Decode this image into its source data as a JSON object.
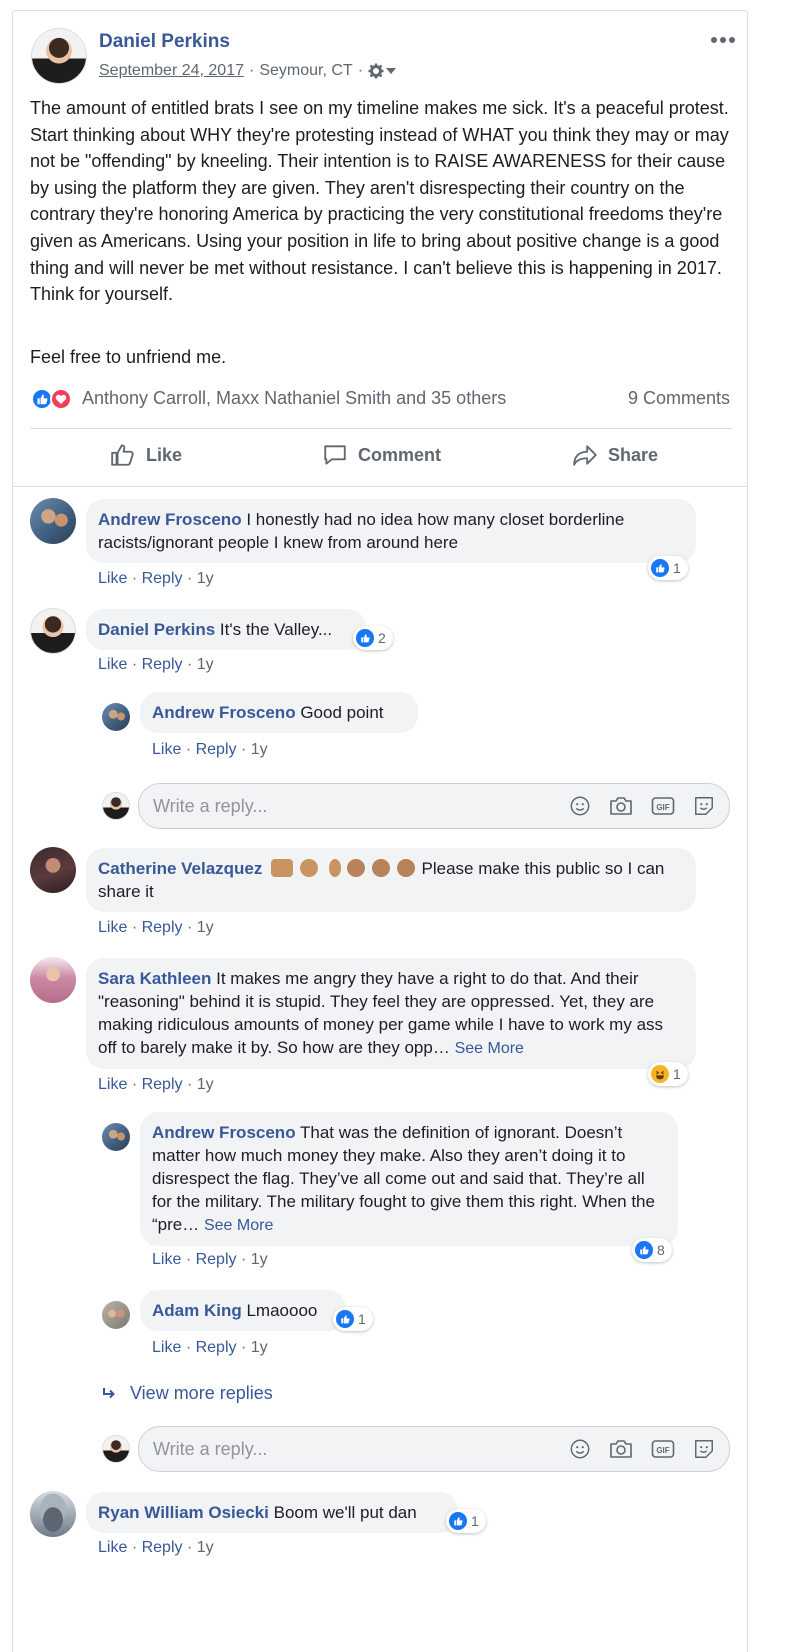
{
  "post": {
    "author": "Daniel Perkins",
    "date": "September 24, 2017",
    "location": "Seymour, CT",
    "separator": "·",
    "menu_icon": "more-horizontal-icon",
    "body": "The amount of entitled brats I see on my timeline makes me sick. It's a peaceful protest. Start thinking about WHY they're protesting instead of WHAT you think they may or may not be \"offending\" by kneeling. Their intention is to RAISE AWARENESS for their cause by using the platform they are given. They aren't disrespecting their country on the contrary they're honoring America by practicing the very constitutional freedoms they're given as Americans. Using your position in life to bring about positive change is a good thing and will never be met without resistance. I can't believe this is happening in 2017. Think for yourself.",
    "footer_line": "Feel free to unfriend me.",
    "reactions_text": "Anthony Carroll, Maxx Nathaniel Smith and 35 others",
    "comments_count": "9 Comments"
  },
  "actions": {
    "like": "Like",
    "comment": "Comment",
    "share": "Share"
  },
  "meta_labels": {
    "like": "Like",
    "reply": "Reply",
    "dot": "·"
  },
  "reply_placeholder": "Write a reply...",
  "see_more": "See More",
  "view_more_replies": "View more replies",
  "comments": [
    {
      "author": "Andrew Frosceno",
      "text": "I honestly had no idea how many closet borderline racists/ignorant people I knew from around here",
      "time": "1y",
      "reaction_count": "1"
    },
    {
      "author": "Daniel Perkins",
      "text": "It's the Valley...",
      "time": "1y",
      "reaction_count": "2"
    },
    {
      "author": "Andrew Frosceno",
      "text": "Good point",
      "time": "1y"
    },
    {
      "author": "Catherine Velazquez",
      "text": "Please make this public so I can share it",
      "time": "1y"
    },
    {
      "author": "Sara Kathleen",
      "text": "It makes me angry they have a right to do that. And their \"reasoning\" behind it is stupid. They feel they are oppressed. Yet, they are making ridiculous amounts of money per game while I have to work my ass off to barely make it by. So how are they opp…",
      "time": "1y",
      "reaction_count": "1"
    },
    {
      "author": "Andrew Frosceno",
      "text": "That was the definition of ignorant. Doesn’t matter how much money they make. Also they aren’t doing it to disrespect the flag. They’ve all come out and said that. They’re all for the military. The military fought to give them this right. When the “pre…",
      "time": "1y",
      "reaction_count": "8"
    },
    {
      "author": "Adam King",
      "text": "Lmaoooo",
      "time": "1y",
      "reaction_count": "1"
    },
    {
      "author": "Ryan William Osiecki",
      "text": "Boom we'll put dan",
      "time": "1y",
      "reaction_count": "1"
    }
  ],
  "colors": {
    "link": "#385898",
    "like_blue": "#1877f2",
    "love_red": "#f33e58",
    "bubble": "#f2f3f5"
  }
}
